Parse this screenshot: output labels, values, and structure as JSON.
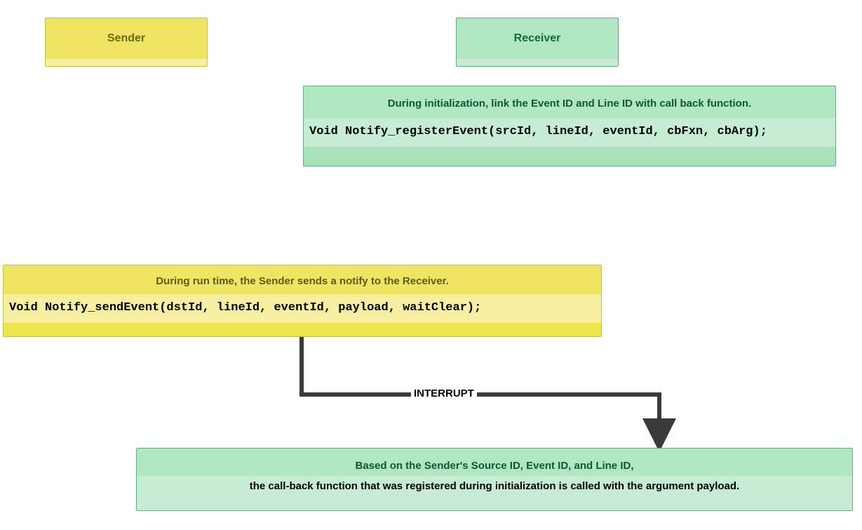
{
  "sender": {
    "label": "Sender"
  },
  "receiver": {
    "label": "Receiver"
  },
  "init_box": {
    "desc": "During initialization, link the Event ID and Line ID with call back function.",
    "code": "Void Notify_registerEvent(srcId, lineId, eventId, cbFxn, cbArg);"
  },
  "runtime_box": {
    "desc": "During run time, the Sender sends a notify to the Receiver.",
    "code": "Void Notify_sendEvent(dstId, lineId, eventId, payload, waitClear);"
  },
  "interrupt_label": "INTERRUPT",
  "callback_box": {
    "line1": "Based on the Sender's Source ID, Event ID, and Line ID,",
    "line2": "the call-back function that was registered during initialization is called with the argument payload."
  }
}
